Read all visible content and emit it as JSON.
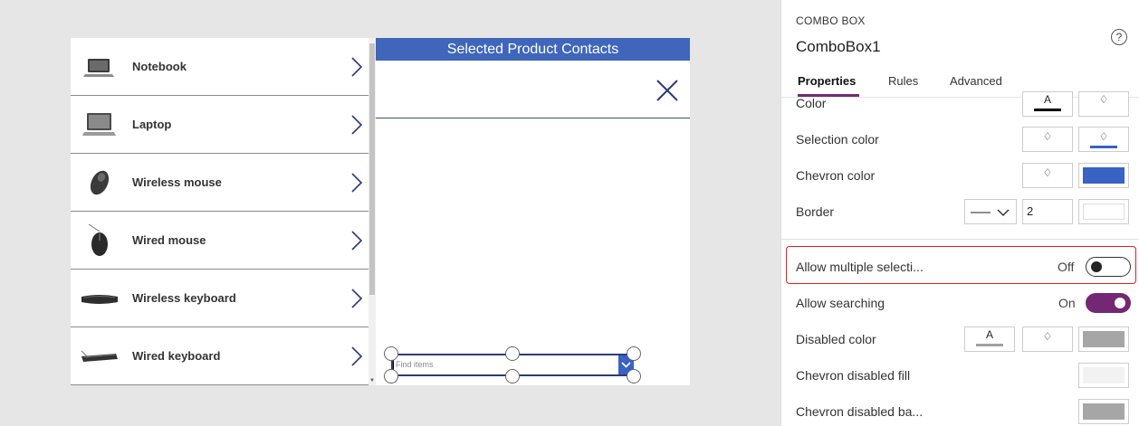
{
  "gallery": {
    "items": [
      {
        "label": "Notebook",
        "icon": "notebook-icon"
      },
      {
        "label": "Laptop",
        "icon": "laptop-icon"
      },
      {
        "label": "Wireless mouse",
        "icon": "wireless-mouse-icon"
      },
      {
        "label": "Wired mouse",
        "icon": "wired-mouse-icon"
      },
      {
        "label": "Wireless keyboard",
        "icon": "wireless-keyboard-icon"
      },
      {
        "label": "Wired keyboard",
        "icon": "wired-keyboard-icon"
      }
    ]
  },
  "detail": {
    "header": "Selected Product Contacts",
    "combo_placeholder": "Find items"
  },
  "panel": {
    "control_type": "COMBO BOX",
    "control_name": "ComboBox1",
    "help": "?",
    "tabs": [
      "Properties",
      "Rules",
      "Advanced"
    ],
    "rows": {
      "color": "Color",
      "selection_color": "Selection color",
      "chevron_color": "Chevron color",
      "border": "Border",
      "border_width": "2",
      "allow_multiple": "Allow multiple selecti...",
      "allow_multiple_state": "Off",
      "allow_searching": "Allow searching",
      "allow_searching_state": "On",
      "disabled_color": "Disabled color",
      "chevron_disabled_fill": "Chevron disabled fill",
      "chevron_disabled_ba": "Chevron disabled ba..."
    },
    "font_glyph": "A"
  },
  "colors": {
    "header_blue": "#3f66ba",
    "chevron_blue": "#3862c4",
    "accent_purple": "#742774",
    "highlight_red": "#e02020"
  }
}
